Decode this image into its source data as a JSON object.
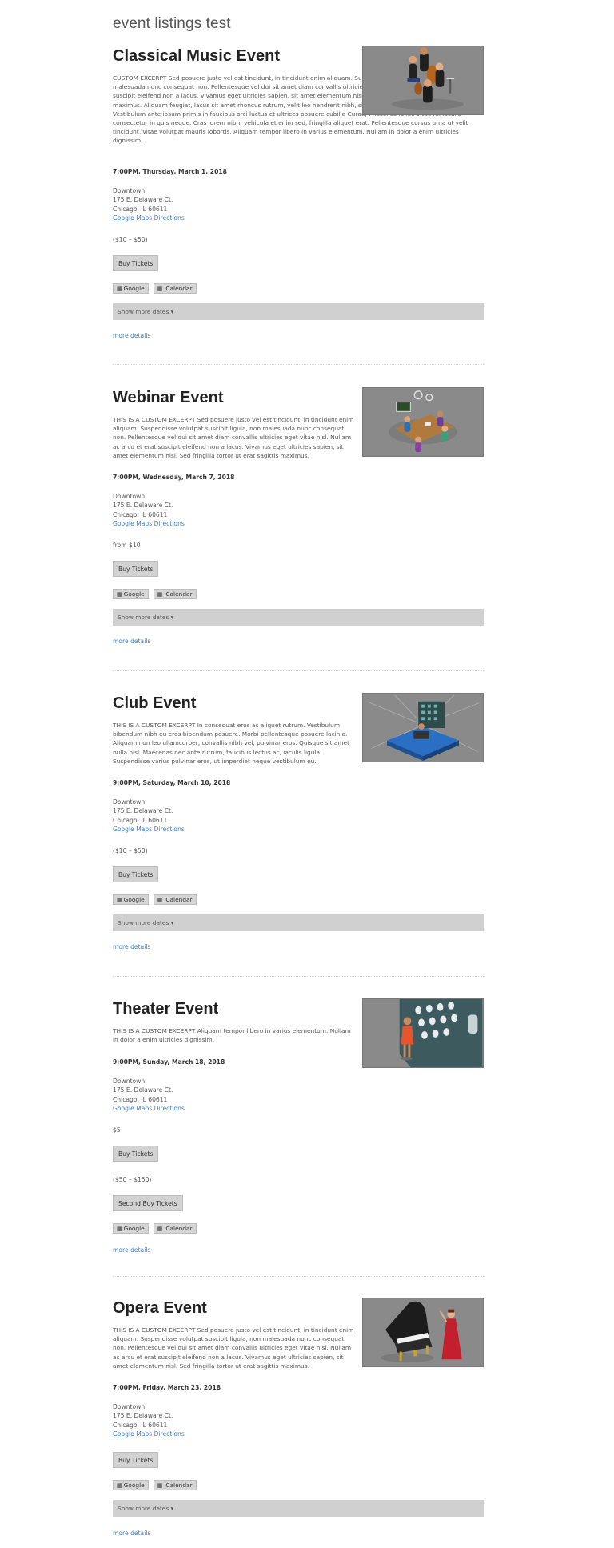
{
  "page": {
    "title": "event listings test"
  },
  "labels": {
    "buy_tickets": "Buy Tickets",
    "second_buy_tickets": "Second Buy Tickets",
    "google": "Google",
    "icalendar": "iCalendar",
    "show_more_dates": "Show more dates ▾",
    "more_details": "more details",
    "google_maps_directions": "Google Maps Directions"
  },
  "icons": {
    "calendar": "calendar-icon"
  },
  "events": [
    {
      "title": "Classical Music Event",
      "excerpt": "CUSTOM EXCERPT Sed posuere justo vel est tincidunt, in tincidunt enim aliquam. Suspendisse volutpat suscipit ligula, non malesuada nunc consequat non. Pellentesque vel dui sit amet diam convallis ultricies eget vitae nisl. Nullam ac arcu et erat suscipit eleifend non a lacus. Vivamus eget ultricies sapien, sit amet elementum nisl. Sed fringilla tortor ut erat sagittis maximus. Aliquam feugiat, lacus sit amet rhoncus rutrum, velit leo hendrerit nibh, sit amet tincidunt odio sapien vitae felis. Vestibulum ante ipsum primis in faucibus orci luctus et ultrices posuere cubilia Curae; Phasellus id leo vitae mi iaculis consectetur in quis neque. Cras lorem nibh, vehicula et enim sed, fringilla aliquet erat. Pellentesque cursus urna ut velit tincidunt, vitae volutpat mauris lobortis. Aliquam tempor libero in varius elementum. Nullam in dolor a enim ultricies dignissim.",
      "date": "7:00PM, Thursday, March 1, 2018",
      "venue": "Downtown",
      "street": "175 E. Delaware Ct.",
      "city": "Chicago, IL 60611",
      "price": "($10 – $50)"
    },
    {
      "title": "Webinar Event",
      "excerpt": "THIS IS A CUSTOM EXCERPT Sed posuere justo vel est tincidunt, in tincidunt enim aliquam. Suspendisse volutpat suscipit ligula, non malesuada nunc consequat non. Pellentesque vel dui sit amet diam convallis ultricies eget vitae nisl. Nullam ac arcu et erat suscipit eleifend non a lacus. Vivamus eget ultricies sapien, sit amet elementum nisl. Sed fringilla tortor ut erat sagittis maximus.",
      "date": "7:00PM, Wednesday, March 7, 2018",
      "venue": "Downtown",
      "street": "175 E. Delaware Ct.",
      "city": "Chicago, IL 60611",
      "price": "from $10"
    },
    {
      "title": "Club Event",
      "excerpt": "THIS IS A CUSTOM EXCERPT In consequat eros ac aliquet rutrum. Vestibulum bibendum nibh eu eros bibendum posuere. Morbi pellentesque posuere lacinia. Aliquam non leo ullamcorper, convallis nibh vel, pulvinar eros. Quisque sit amet nulla nisl. Maecenas nec ante rutrum, faucibus lectus ac, iaculis ligula. Suspendisse varius pulvinar eros, ut imperdiet neque vestibulum eu.",
      "date": "9:00PM, Saturday, March 10, 2018",
      "venue": "Downtown",
      "street": "175 E. Delaware Ct.",
      "city": "Chicago, IL 60611",
      "price": "($10 – $50)"
    },
    {
      "title": "Theater Event",
      "excerpt": "THIS IS A CUSTOM EXCERPT Aliquam tempor libero in varius elementum. Nullam in dolor a enim ultricies dignissim.",
      "date": "9:00PM, Sunday, March 18, 2018",
      "venue": "Downtown",
      "street": "175 E. Delaware Ct.",
      "city": "Chicago, IL 60611",
      "price": "$5",
      "second_price": "($50 – $150)"
    },
    {
      "title": "Opera Event",
      "excerpt": "THIS IS A CUSTOM EXCERPT Sed posuere justo vel est tincidunt, in tincidunt enim aliquam. Suspendisse volutpat suscipit ligula, non malesuada nunc consequat non. Pellentesque vel dui sit amet diam convallis ultricies eget vitae nisl. Nullam ac arcu et erat suscipit eleifend non a lacus. Vivamus eget ultricies sapien, sit amet elementum nisl. Sed fringilla tortor ut erat sagittis maximus.",
      "date": "7:00PM, Friday, March 23, 2018",
      "venue": "Downtown",
      "street": "175 E. Delaware Ct.",
      "city": "Chicago, IL 60611"
    }
  ]
}
